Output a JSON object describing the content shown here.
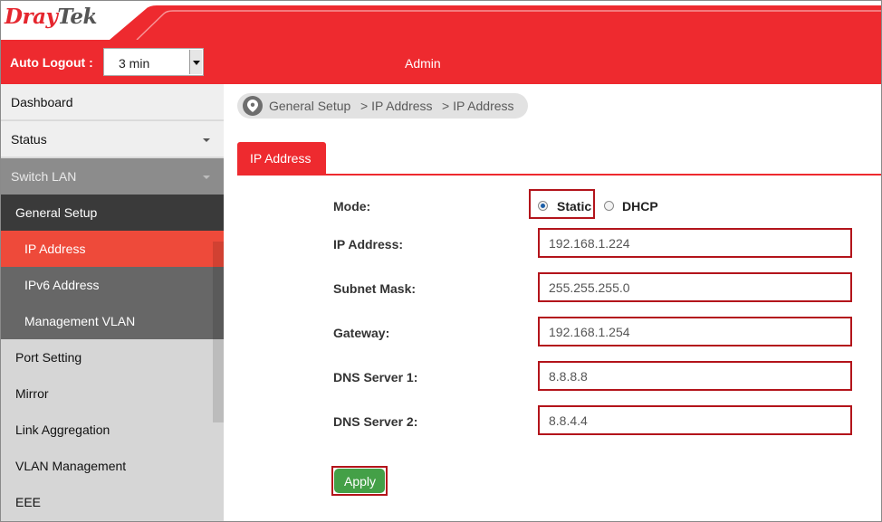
{
  "brand": {
    "logo_part1": "Dray",
    "logo_part2": "Tek",
    "accent": "#ee2a2f"
  },
  "header": {
    "auto_logout_label": "Auto Logout :",
    "auto_logout_value": "3 min",
    "user": "Admin"
  },
  "sidebar": {
    "dashboard": "Dashboard",
    "status": "Status",
    "switch_lan": "Switch LAN",
    "general_setup": "General Setup",
    "ip_address": "IP Address",
    "ipv6_address": "IPv6 Address",
    "management_vlan": "Management VLAN",
    "port_setting": "Port Setting",
    "mirror": "Mirror",
    "link_aggregation": "Link Aggregation",
    "vlan_management": "VLAN Management",
    "eee": "EEE"
  },
  "breadcrumb": {
    "icon": "location-pin-icon",
    "c1": "General Setup",
    "c2": "> IP Address",
    "c3": "> IP Address"
  },
  "tab": {
    "label": "IP Address"
  },
  "form": {
    "mode_label": "Mode:",
    "mode_static": "Static",
    "mode_dhcp": "DHCP",
    "mode_selected": "Static",
    "ip_label": "IP Address:",
    "ip_value": "192.168.1.224",
    "subnet_label": "Subnet Mask:",
    "subnet_value": "255.255.255.0",
    "gateway_label": "Gateway:",
    "gateway_value": "192.168.1.254",
    "dns1_label": "DNS Server 1:",
    "dns1_value": "8.8.8.8",
    "dns2_label": "DNS Server 2:",
    "dns2_value": "8.8.4.4",
    "apply": "Apply"
  }
}
